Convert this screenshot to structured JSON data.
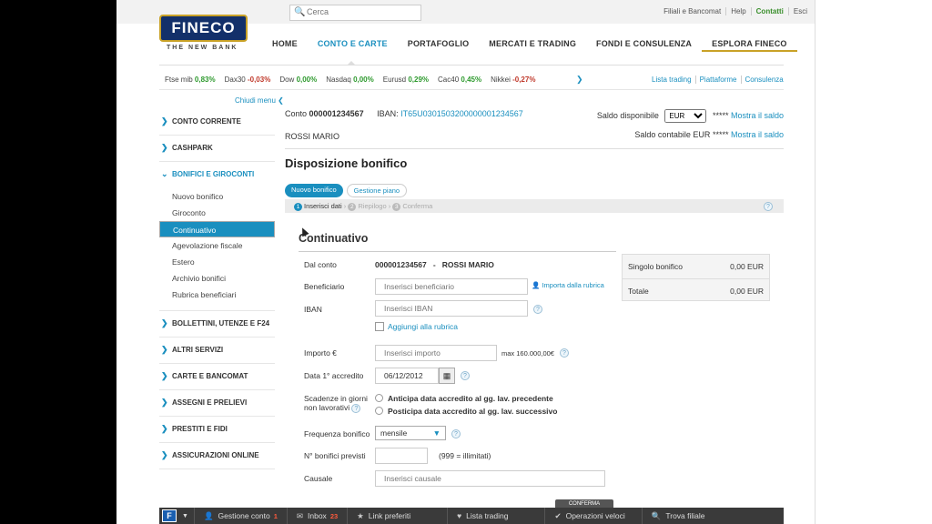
{
  "brand": {
    "name": "FINECO",
    "tagline": "THE NEW BANK"
  },
  "search": {
    "placeholder": "Cerca"
  },
  "top_links": [
    "Filiali e Bancomat",
    "Help",
    "Contatti",
    "Esci"
  ],
  "nav": [
    "HOME",
    "CONTO E CARTE",
    "PORTAFOGLIO",
    "MERCATI E TRADING",
    "FONDI E CONSULENZA",
    "ESPLORA FINECO"
  ],
  "ticker": [
    {
      "name": "Ftse mib",
      "value": "0,83%",
      "dir": "up"
    },
    {
      "name": "Dax30",
      "value": "-0,03%",
      "dir": "dn"
    },
    {
      "name": "Dow",
      "value": "0,00%",
      "dir": "up"
    },
    {
      "name": "Nasdaq",
      "value": "0,00%",
      "dir": "up"
    },
    {
      "name": "Eurusd",
      "value": "0,29%",
      "dir": "up"
    },
    {
      "name": "Cac40",
      "value": "0,45%",
      "dir": "up"
    },
    {
      "name": "Nikkei",
      "value": "-0,27%",
      "dir": "dn"
    }
  ],
  "trade_links": [
    "Lista trading",
    "Piattaforme",
    "Consulenza"
  ],
  "sidebar": {
    "collapse": "Chiudi menu",
    "items": [
      "CONTO CORRENTE",
      "CASHPARK",
      "BONIFICI E GIROCONTI",
      "BOLLETTINI, UTENZE E F24",
      "ALTRI SERVIZI",
      "CARTE E BANCOMAT",
      "ASSEGNI E PRELIEVI",
      "PRESTITI E FIDI",
      "ASSICURAZIONI ONLINE"
    ],
    "sub": [
      "Nuovo bonifico",
      "Giroconto",
      "Continuativo",
      "Agevolazione fiscale",
      "Estero",
      "Archivio bonifici",
      "Rubrica beneficiari"
    ]
  },
  "account": {
    "conto_label": "Conto",
    "conto": "000001234567",
    "iban_label": "IBAN:",
    "iban": "IT65U0301503200000001234567",
    "holder": "ROSSI MARIO",
    "saldo_disp_label": "Saldo disponibile",
    "currency": "EUR",
    "masked": "*****",
    "show": "Mostra il saldo",
    "saldo_cont_label": "Saldo contabile EUR"
  },
  "page_title": "Disposizione bonifico",
  "pills": [
    "Nuovo bonifico",
    "Gestione piano"
  ],
  "steps": [
    "Inserisci dati",
    "Riepilogo",
    "Conferma"
  ],
  "form": {
    "section": "Continuativo",
    "dal_conto_label": "Dal conto",
    "dal_conto": "000001234567",
    "sep": "-",
    "dal_conto_name": "ROSSI MARIO",
    "beneficiario_label": "Beneficiario",
    "beneficiario_ph": "Inserisci beneficiario",
    "rubrica_link": "Importa dalla rubrica",
    "iban_label": "IBAN",
    "iban_ph": "Inserisci IBAN",
    "aggiungi": "Aggiungi alla rubrica",
    "importo_label": "Importo €",
    "importo_ph": "Inserisci importo",
    "max": "max 160.000,00€",
    "data_label": "Data 1° accredito",
    "data": "06/12/2012",
    "scadenze_label1": "Scadenze in giorni",
    "scadenze_label2": "non lavorativi",
    "anticipa": "Anticipa data accredito al gg. lav. precedente",
    "posticipa": "Posticipa data accredito al gg. lav. successivo",
    "frequenza_label": "Frequenza bonifico",
    "frequenza": "mensile",
    "previsti_label": "N° bonifici previsti",
    "previsti_hint": "(999 = illimitati)",
    "causale_label": "Causale",
    "causale_ph": "Inserisci causale",
    "confirm": "CONFERMA"
  },
  "summary": {
    "singolo_label": "Singolo bonifico",
    "singolo": "0,00 EUR",
    "totale_label": "Totale",
    "totale": "0,00 EUR"
  },
  "bottom_bar": {
    "logo": "F",
    "items": [
      {
        "label": "Gestione conto",
        "badge": "1",
        "icon": "user-icon"
      },
      {
        "label": "Inbox",
        "badge": "23",
        "icon": "mail-icon"
      },
      {
        "label": "Link preferiti",
        "badge": "",
        "icon": "star-icon"
      },
      {
        "label": "Lista trading",
        "badge": "",
        "icon": "heart-icon"
      },
      {
        "label": "Operazioni veloci",
        "badge": "",
        "icon": "check-icon"
      },
      {
        "label": "Trova filiale",
        "badge": "",
        "icon": "search-icon"
      }
    ]
  }
}
